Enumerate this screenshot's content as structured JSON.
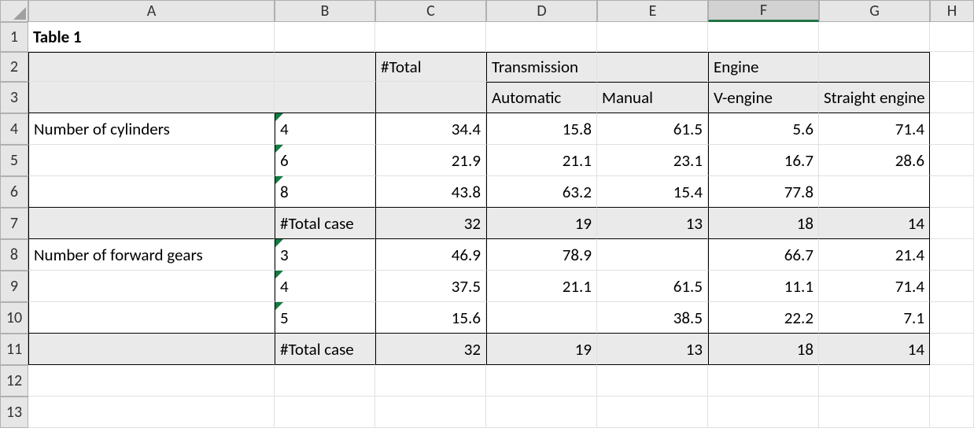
{
  "columns": [
    "A",
    "B",
    "C",
    "D",
    "E",
    "F",
    "G",
    "H"
  ],
  "rows": [
    "1",
    "2",
    "3",
    "4",
    "5",
    "6",
    "7",
    "8",
    "9",
    "10",
    "11",
    "12",
    "13"
  ],
  "active_column": "F",
  "a1": "Table 1",
  "headers": {
    "total": "#Total",
    "transmission": "Transmission",
    "engine": "Engine",
    "automatic": "Automatic",
    "manual": "Manual",
    "vengine": "V-engine",
    "straight": "Straight engine"
  },
  "rowlabels": {
    "cyl": "Number of cylinders",
    "gears": "Number of forward gears",
    "totalcase": "#Total case"
  },
  "cyl": {
    "r4": {
      "b": "4",
      "c": "34.4",
      "d": "15.8",
      "e": "61.5",
      "f": "5.6",
      "g": "71.4"
    },
    "r5": {
      "b": "6",
      "c": "21.9",
      "d": "21.1",
      "e": "23.1",
      "f": "16.7",
      "g": "28.6"
    },
    "r6": {
      "b": "8",
      "c": "43.8",
      "d": "63.2",
      "e": "15.4",
      "f": "77.8",
      "g": ""
    }
  },
  "totcase1": {
    "c": "32",
    "d": "19",
    "e": "13",
    "f": "18",
    "g": "14"
  },
  "gears": {
    "r8": {
      "b": "3",
      "c": "46.9",
      "d": "78.9",
      "e": "",
      "f": "66.7",
      "g": "21.4"
    },
    "r9": {
      "b": "4",
      "c": "37.5",
      "d": "21.1",
      "e": "61.5",
      "f": "11.1",
      "g": "71.4"
    },
    "r10": {
      "b": "5",
      "c": "15.6",
      "d": "",
      "e": "38.5",
      "f": "22.2",
      "g": "7.1"
    }
  },
  "totcase2": {
    "c": "32",
    "d": "19",
    "e": "13",
    "f": "18",
    "g": "14"
  }
}
